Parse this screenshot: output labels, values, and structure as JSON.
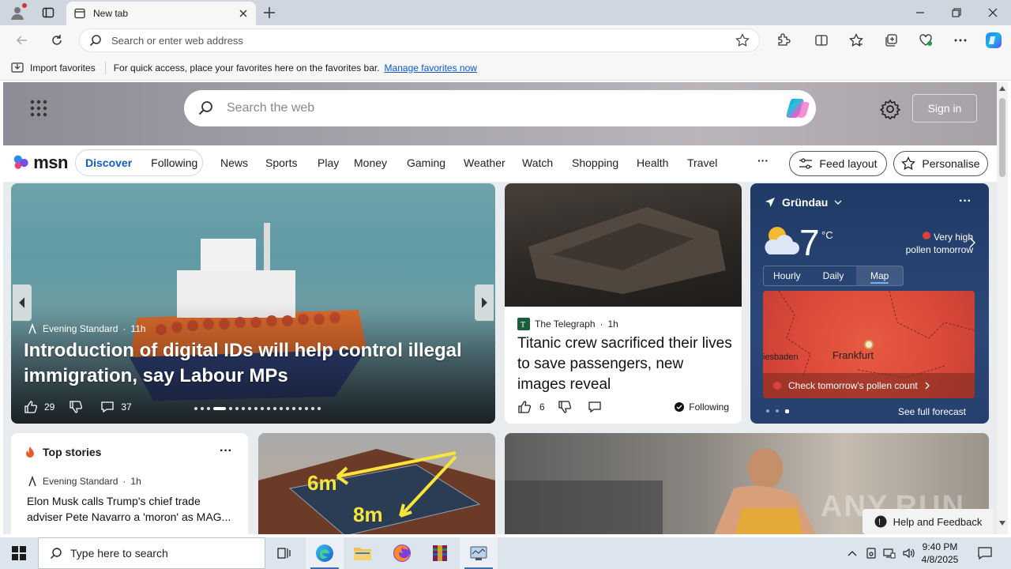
{
  "browser": {
    "tab_title": "New tab",
    "address_placeholder": "Search or enter web address",
    "favorites_bar": {
      "import_label": "Import favorites",
      "message": "For quick access, place your favorites here on the favorites bar.",
      "manage_link": "Manage favorites now"
    }
  },
  "msn": {
    "search_placeholder": "Search the web",
    "signin_label": "Sign in",
    "logo_text": "msn",
    "pill_tabs": [
      "Discover",
      "Following"
    ],
    "nav_links": [
      "News",
      "Sports",
      "Play",
      "Money",
      "Gaming",
      "Weather",
      "Watch",
      "Shopping",
      "Health",
      "Travel"
    ],
    "more_label": "···",
    "feed_layout_label": "Feed layout",
    "personalise_label": "Personalise",
    "hero": {
      "source": "Evening Standard",
      "age": "11h",
      "title": "Introduction of digital IDs will help control illegal immigration, say Labour MPs",
      "likes": "29",
      "comments": "37"
    },
    "titanic": {
      "source": "The Telegraph",
      "age": "1h",
      "title": "Titanic crew sacrificed their lives to save passengers, new images reveal",
      "likes": "6",
      "following_label": "Following"
    },
    "weather": {
      "location": "Gründau",
      "temperature": "7",
      "unit": "°C",
      "pollen_line1": "Very high",
      "pollen_line2": "pollen tomorrow",
      "tabs": [
        "Hourly",
        "Daily",
        "Map"
      ],
      "map_city_main": "Frankfurt",
      "map_city_side": "iesbaden",
      "pollen_check": "Check tomorrow's pollen count",
      "forecast_label": "See full forecast"
    },
    "top_stories": {
      "heading": "Top stories",
      "source": "Evening Standard",
      "age": "1h",
      "title": "Elon Musk calls Trump's chief trade adviser Pete Navarro a 'moron' as MAG..."
    },
    "solar_labels": {
      "first": "6m",
      "second": "8m"
    },
    "watermark": "ANY.RUN",
    "help_label": "Help and Feedback"
  },
  "taskbar": {
    "search_placeholder": "Type here to search",
    "time": "9:40 PM",
    "date": "4/8/2025"
  }
}
